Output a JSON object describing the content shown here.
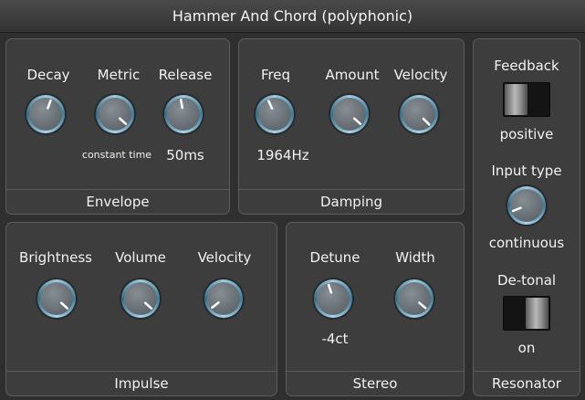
{
  "title": "Hammer And Chord (polyphonic)",
  "panels": {
    "envelope": {
      "name": "Envelope",
      "knobs": [
        {
          "label": "Decay",
          "value": ""
        },
        {
          "label": "Metric",
          "value": "constant time"
        },
        {
          "label": "Release",
          "value": "50ms"
        }
      ]
    },
    "damping": {
      "name": "Damping",
      "knobs": [
        {
          "label": "Freq",
          "value": "1964Hz"
        },
        {
          "label": "Amount",
          "value": ""
        },
        {
          "label": "Velocity",
          "value": ""
        }
      ]
    },
    "impulse": {
      "name": "Impulse",
      "knobs": [
        {
          "label": "Brightness",
          "value": ""
        },
        {
          "label": "Volume",
          "value": ""
        },
        {
          "label": "Velocity",
          "value": ""
        }
      ]
    },
    "stereo": {
      "name": "Stereo",
      "knobs": [
        {
          "label": "Detune",
          "value": "-4ct"
        },
        {
          "label": "Width",
          "value": ""
        }
      ]
    },
    "resonator": {
      "name": "Resonator",
      "feedback": {
        "label": "Feedback",
        "value": "positive"
      },
      "input_type": {
        "label": "Input type",
        "value": "continuous"
      },
      "detonal": {
        "label": "De-tonal",
        "value": "on"
      }
    }
  },
  "colors": {
    "knob_ring": "#7fb6cf",
    "knob_indicator": "#ffffff",
    "panel_bg": "#3d3d3d",
    "panel_border": "#5c5c5c"
  }
}
